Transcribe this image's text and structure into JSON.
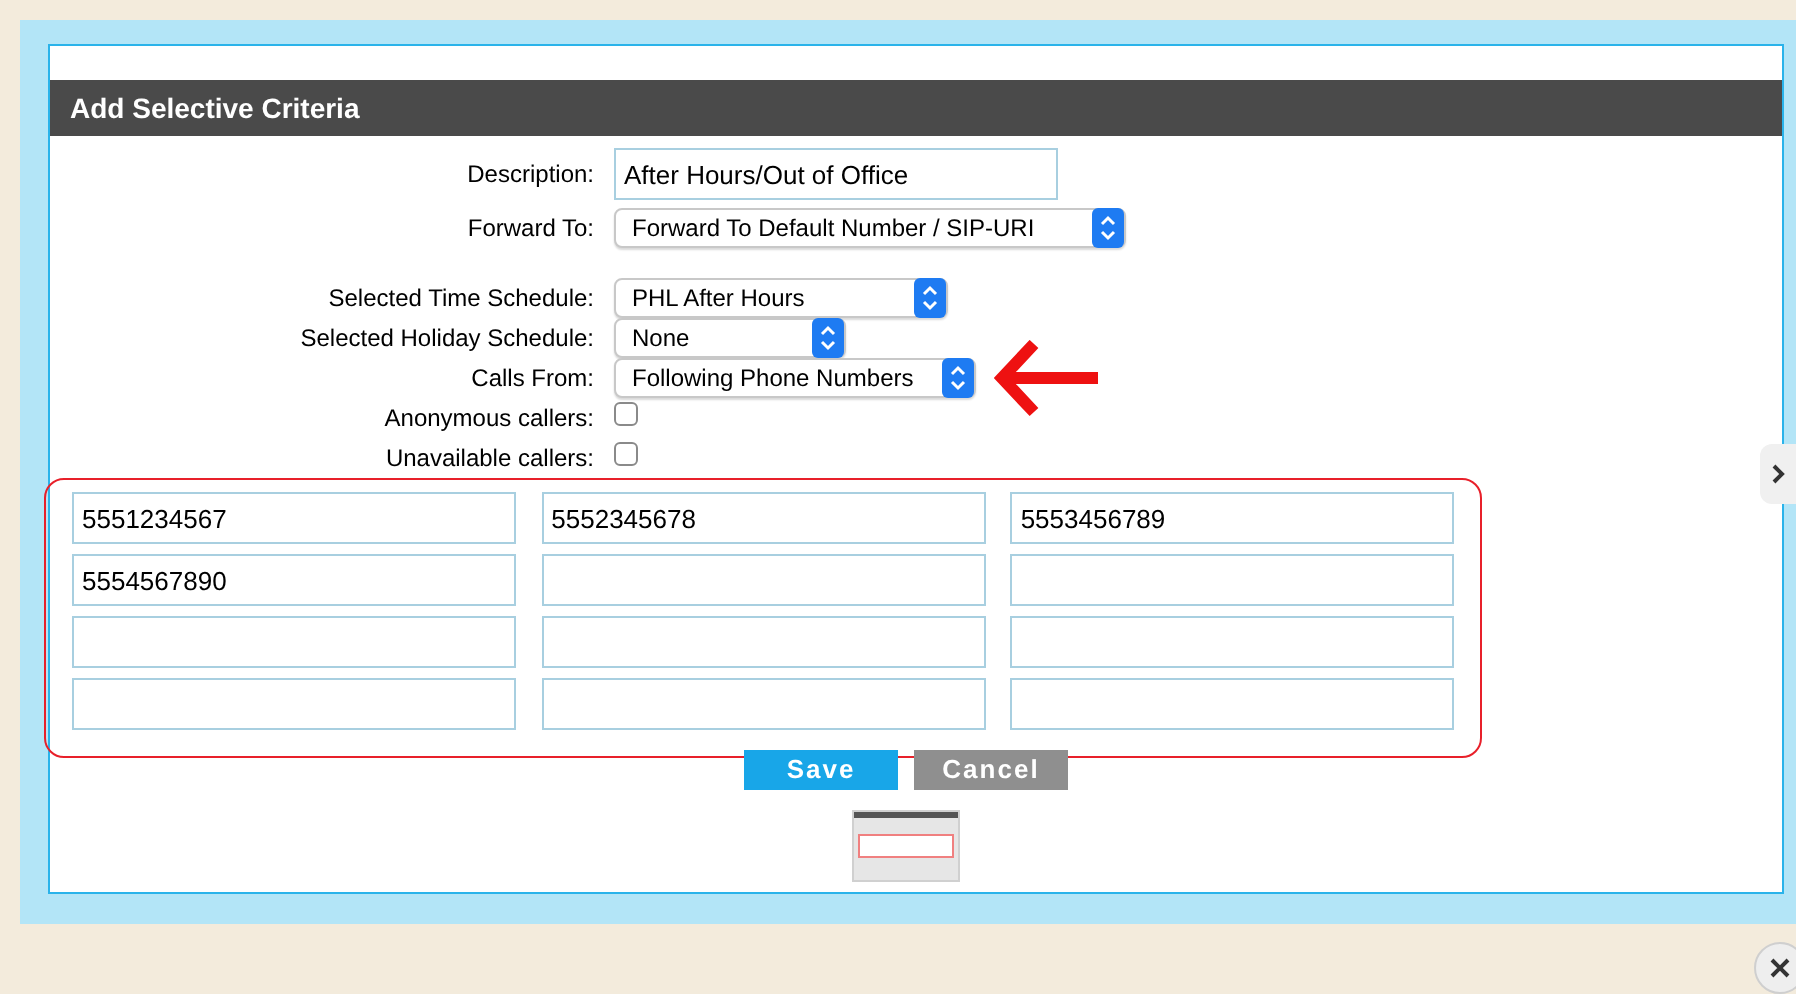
{
  "dialog": {
    "title": "Add Selective Criteria"
  },
  "form": [
    {
      "kind": "text",
      "label": "Description:",
      "value": "After Hours/Out of Office"
    },
    {
      "kind": "select",
      "label": "Forward To:",
      "value": "Forward To Default Number / SIP-URI"
    },
    {
      "kind": "select",
      "label": "Selected Time Schedule:",
      "value": "PHL After Hours"
    },
    {
      "kind": "select",
      "label": "Selected Holiday Schedule:",
      "value": "None"
    },
    {
      "kind": "select",
      "label": "Calls From:",
      "value": "Following Phone Numbers"
    },
    {
      "kind": "checkbox",
      "label": "Anonymous callers:",
      "checked": false
    },
    {
      "kind": "checkbox",
      "label": "Unavailable callers:",
      "checked": false
    }
  ],
  "phone_numbers": [
    "5551234567",
    "5552345678",
    "5553456789",
    "5554567890"
  ],
  "buttons": [
    "Save",
    "Cancel"
  ]
}
